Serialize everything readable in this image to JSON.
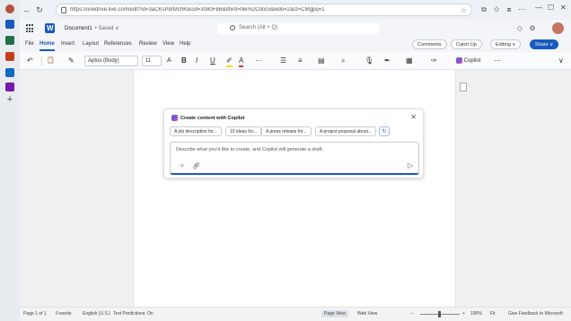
{
  "browser": {
    "url": "https://onedrive.live.com/edit?id=3aCKsP8rMchK&cid=3080F8B&ithint=file%2Cdocx&wdo=2&ct=CMgpq=1",
    "nav": {
      "back": "←",
      "forward": "→",
      "refresh": "↻"
    },
    "favorite": "☆"
  },
  "word": {
    "doc_name": "Document1",
    "saved_status": "• Saved ∨",
    "search_placeholder": "Search (Alt + Q)"
  },
  "ribbon": {
    "tabs": [
      "File",
      "Home",
      "Insert",
      "Layout",
      "References",
      "Review",
      "View",
      "Help"
    ],
    "active_tab": "Home",
    "comments_label": "Comments",
    "catchup_label": "Catch Up",
    "editing_label": "Editing ∨",
    "share_label": "Share ∨"
  },
  "toolbar": {
    "undo": "↶",
    "paste": "📋",
    "font_name": "Aptos (Body)",
    "font_size": "11",
    "bold": "B",
    "italic": "I",
    "underline": "U",
    "more": "···",
    "copilot_label": "Copilot"
  },
  "copilot": {
    "title": "Create content with Copilot",
    "close": "✕",
    "chips": [
      "A job description for...",
      "10 ideas for...",
      "A press release for...",
      "A project proposal about..."
    ],
    "refresh": "↻",
    "input_placeholder": "Describe what you'd like to create, and Copilot will generate a draft.",
    "send": "▷"
  },
  "statusbar": {
    "page": "Page 1 of 1",
    "words": "0 words",
    "language": "English (U.S.)",
    "text_predictions": "Text Predictions: On",
    "page_view": "Page View",
    "web_view": "Web View",
    "zoom": "100%",
    "fit": "Fit",
    "feedback": "Give Feedback to Microsoft"
  },
  "colors": {
    "accent": "#185abd",
    "brand_word": "#185abd"
  }
}
